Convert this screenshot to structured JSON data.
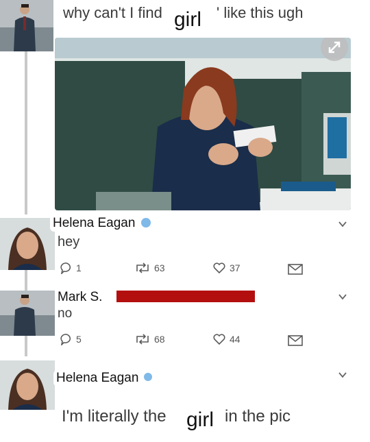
{
  "top_tweet": {
    "text_before": "why can't I find",
    "overlay_word": "girl",
    "text_after": "' like this ugh"
  },
  "expand_icon": "expand-arrows-icon",
  "replies": [
    {
      "author": "Helena Eagan",
      "verified": true,
      "text": "hey",
      "stats": {
        "replies": "1",
        "retweets": "63",
        "likes": "37"
      }
    },
    {
      "author": "Mark S.",
      "text": "no",
      "stats": {
        "replies": "5",
        "retweets": "68",
        "likes": "44"
      }
    },
    {
      "author": "Helena Eagan",
      "verified": true,
      "text_before": "I'm literally the",
      "overlay_word": "girl",
      "text_after": "in the pic"
    }
  ],
  "colors": {
    "accent": "#7fb9e8",
    "redaction": "#b40f0f",
    "icon": "#5a5a5a"
  }
}
